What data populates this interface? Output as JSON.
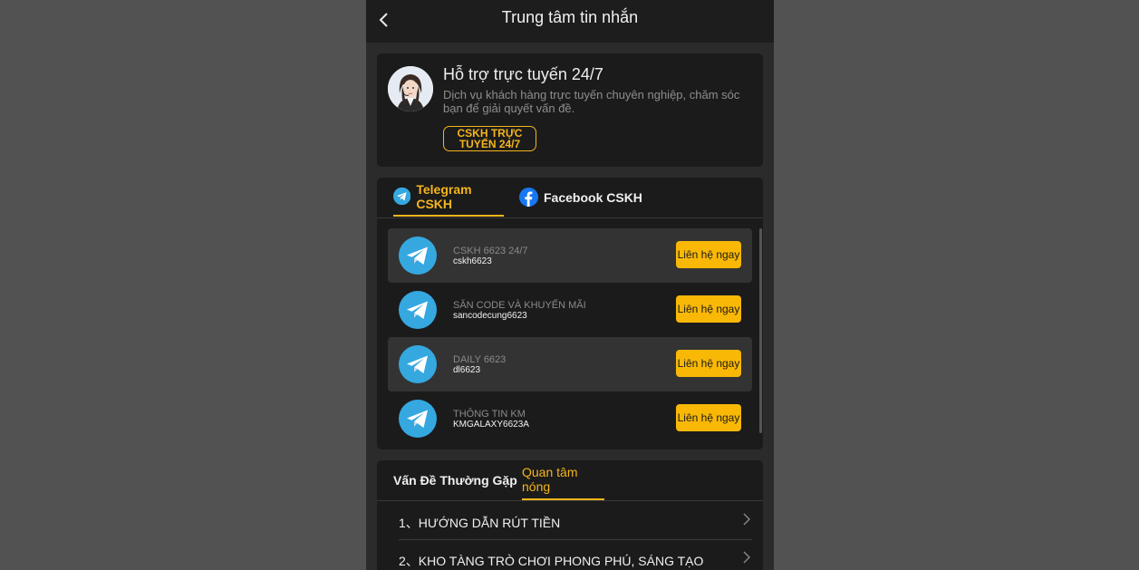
{
  "header": {
    "title": "Trung tâm tin nhắn"
  },
  "support": {
    "title": "Hỗ trợ trực tuyến 24/7",
    "description": "Dịch vụ khách hàng trực tuyến chuyên nghiệp, chăm sóc bạn để giải quyết vấn đề.",
    "button_label": "CSKH TRỰC TUYẾN 24/7"
  },
  "channel_tabs": [
    {
      "label": "Telegram CSKH",
      "icon": "telegram-icon",
      "active": true
    },
    {
      "label": "Facebook CSKH",
      "icon": "facebook-icon",
      "active": false
    }
  ],
  "contacts": [
    {
      "name": "CSKH 6623 24/7",
      "handle": "cskh6623",
      "button": "Liên hệ ngay",
      "highlighted": true
    },
    {
      "name": "SĂN CODE VÀ KHUYẾN MÃI",
      "handle": "sancodecung6623",
      "button": "Liên hệ ngay",
      "highlighted": false
    },
    {
      "name": "DAILY 6623",
      "handle": "dl6623",
      "button": "Liên hệ ngay",
      "highlighted": true
    },
    {
      "name": "THÔNG TIN KM",
      "handle": "KMGALAXY6623A",
      "button": "Liên hệ ngay",
      "highlighted": false
    }
  ],
  "faq_tabs": [
    {
      "label": "Vấn Đề Thường Gặp",
      "active": false
    },
    {
      "label": "Quan tâm nóng",
      "active": true
    }
  ],
  "faq_items": [
    {
      "label": "1、HƯỚNG DẪN RÚT TIỀN"
    },
    {
      "label": "2、KHO TÀNG TRÒ CHƠI PHONG PHÚ, SÁNG TẠO"
    }
  ],
  "colors": {
    "accent": "#f5b51c",
    "button": "#f9b806",
    "telegram": "#35a8e0",
    "facebook": "#1877f2"
  }
}
